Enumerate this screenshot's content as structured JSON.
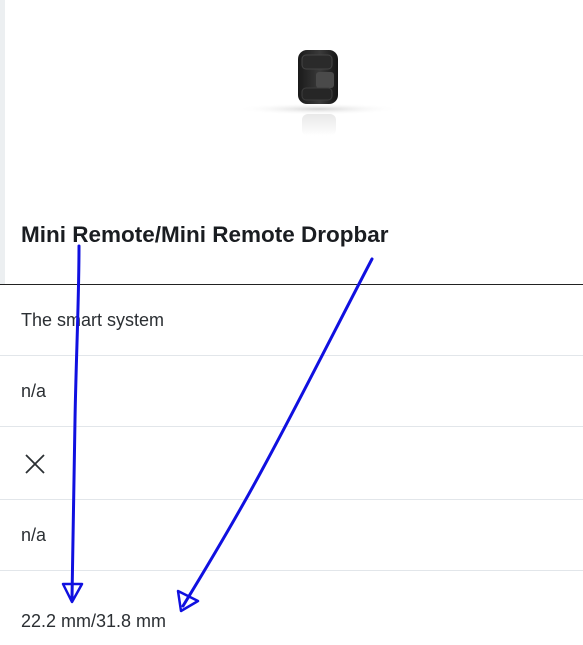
{
  "product": {
    "title": "Mini Remote/Mini Remote Dropbar",
    "image_icon": "mini-remote-device-photo"
  },
  "specs": [
    {
      "value": "The smart system"
    },
    {
      "value": "n/a"
    },
    {
      "value": "",
      "icon": "cross-icon",
      "meaning": "not available"
    },
    {
      "value": "n/a"
    },
    {
      "value": "22.2 mm/31.8 mm"
    }
  ],
  "annotation": {
    "color": "#1010e0",
    "arrows": [
      "arrow-to-22-2-mm",
      "arrow-to-31-8-mm"
    ]
  },
  "colors": {
    "title": "#1a1d21",
    "text": "#2b2f33",
    "divider": "#222222",
    "row_border": "#e2e6ea",
    "annotation": "#1010e0"
  }
}
